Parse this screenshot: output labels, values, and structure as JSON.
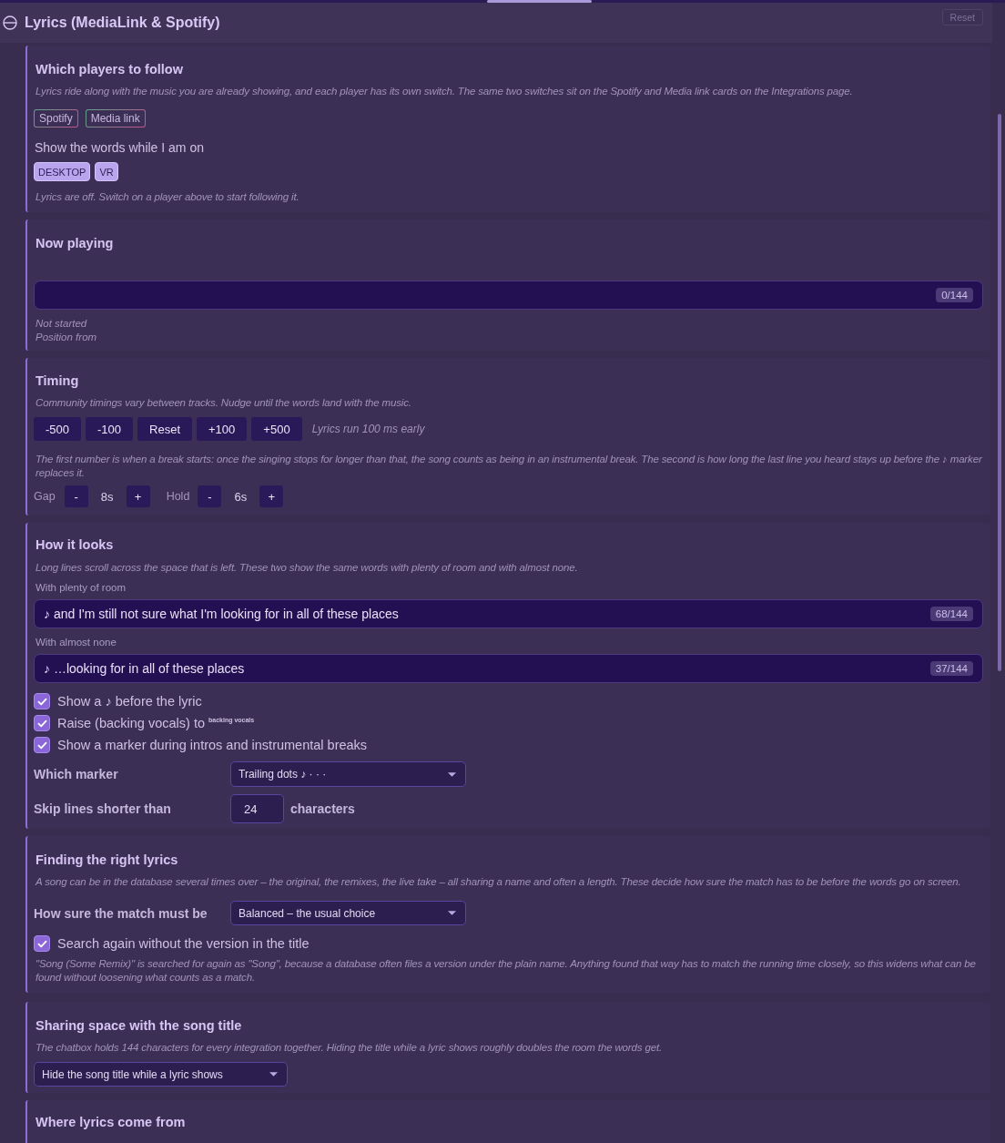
{
  "header": {
    "title": "Lyrics (MediaLink & Spotify)",
    "expanded": true,
    "reset_button": {
      "label": "Reset",
      "disabled": true
    }
  },
  "players": {
    "title": "Which players to follow",
    "description": "Lyrics ride along with the music you are already showing, and each player has its own switch. The same two switches sit on the Spotify and Media link cards on the Integrations page.",
    "players": [
      {
        "label": "Spotify",
        "selected": false
      },
      {
        "label": "Media link",
        "selected": false
      }
    ],
    "modes_label": "Show the words while I am on",
    "modes": [
      {
        "label": "DESKTOP",
        "selected": true
      },
      {
        "label": "VR",
        "selected": true
      }
    ],
    "status": "Lyrics are off. Switch on a player above to start following it."
  },
  "now_playing": {
    "title": "Now playing",
    "counter": "0/144",
    "state": "Not started",
    "position": "Position from"
  },
  "timing": {
    "title": "Timing",
    "description": "Community timings vary between tracks. Nudge until the words land with the music.",
    "offset_buttons": [
      "-500",
      "-100",
      "Reset",
      "+100",
      "+500"
    ],
    "offset_reading": "Lyrics run 100 ms early",
    "break_help": "The first number is when a break starts: once the singing stops for longer than that, the song counts as being in an instrumental break. The second is how long the last line you heard stays up before the ♪ marker replaces it.",
    "steppers": [
      {
        "label": "Gap",
        "minus": "-",
        "value": "8s",
        "plus": "+"
      },
      {
        "label": "Hold",
        "minus": "-",
        "value": "6s",
        "plus": "+"
      }
    ]
  },
  "looks": {
    "title": "How it looks",
    "description": "Long lines scroll across the space that is left. These two show the same words with plenty of room and with almost none.",
    "previews": [
      {
        "label": "With plenty of room",
        "text": "♪ and I'm still not sure what I'm looking for in all of these places",
        "counter": "68/144"
      },
      {
        "label": "With almost none",
        "text": "♪ …looking for in all of these places",
        "counter": "37/144"
      }
    ],
    "options": [
      {
        "label": "Show a ♪ before the lyric",
        "checked": true
      },
      {
        "label": "Raise (backing vocals) to $^{backing vocals}$",
        "checked": true
      },
      {
        "label": "Show a marker during intros and instrumental breaks",
        "checked": true
      }
    ],
    "marker": {
      "label": "Which marker",
      "value": "Trailing dots ♪ · · ·"
    },
    "skip": {
      "label": "Skip lines shorter than",
      "value": "24",
      "unit": "characters"
    }
  },
  "matching": {
    "title": "Finding the right lyrics",
    "description": "A song can be in the database several times over – the original, the remixes, the live take – all sharing a name and often a length. These decide how sure the match has to be before the words go on screen.",
    "strictness": {
      "label": "How sure the match must be",
      "value": "Balanced – the usual choice"
    },
    "retry": {
      "label": "Search again without the version in the title",
      "checked": true
    },
    "retry_help": "\"Song (Some Remix)\" is searched for again as \"Song\", because a database often files a version under the plain name. Anything found that way has to match the running time closely, so this widens what can be found without loosening what counts as a match."
  },
  "title_sharing": {
    "title": "Sharing space with the song title",
    "description": "The chatbox holds 144 characters for every integration together. Hiding the title while a lyric shows roughly doubles the room the words get.",
    "mode": {
      "value": "Hide the song title while a lyric shows"
    }
  },
  "sources": {
    "title": "Where lyrics come from"
  }
}
